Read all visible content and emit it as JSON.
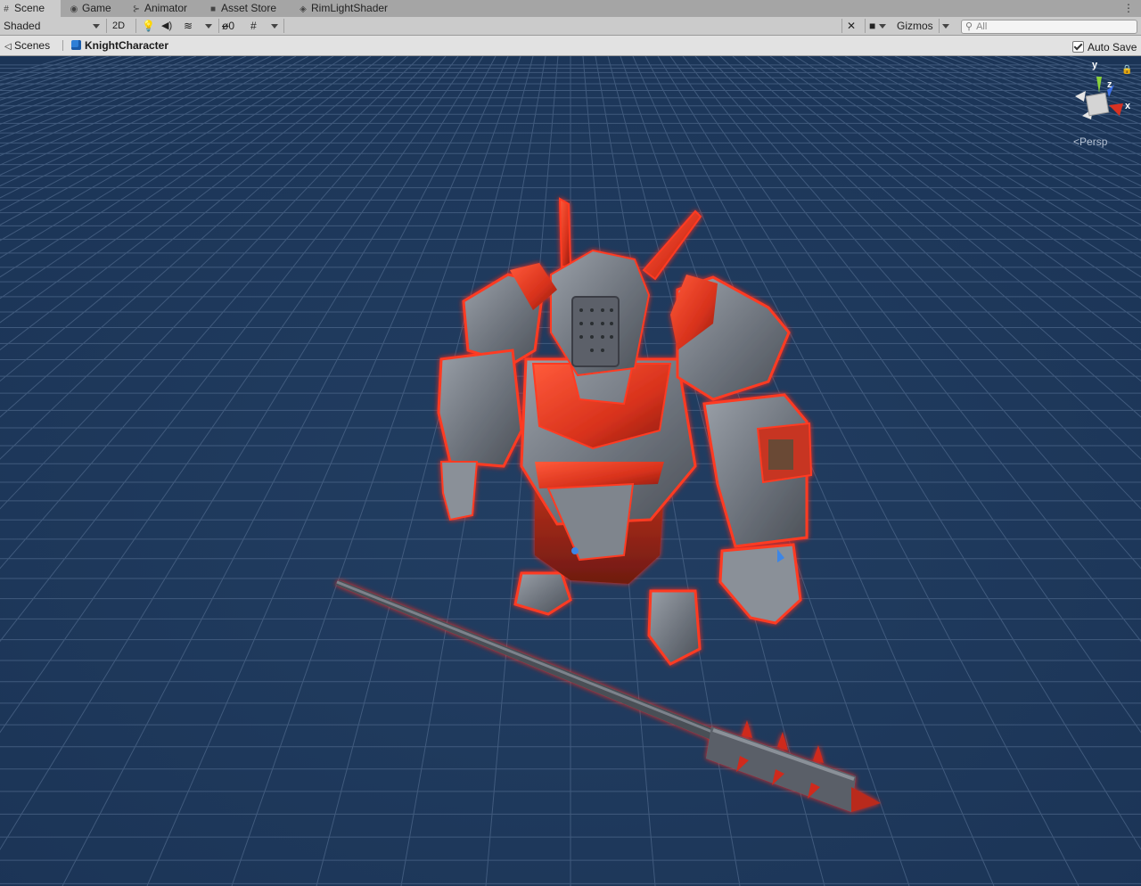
{
  "tabs": [
    {
      "label": "Scene",
      "icon": "grid-icon",
      "active": true
    },
    {
      "label": "Game",
      "icon": "gamepad-icon",
      "active": false
    },
    {
      "label": "Animator",
      "icon": "animator-icon",
      "active": false
    },
    {
      "label": "Asset Store",
      "icon": "bag-icon",
      "active": false
    },
    {
      "label": "RimLightShader",
      "icon": "shader-icon",
      "active": false
    }
  ],
  "toolbar": {
    "draw_mode": "Shaded",
    "two_d": "2D",
    "hidden_count": "0",
    "gizmos": "Gizmos",
    "search_placeholder": "All"
  },
  "breadcrumb": {
    "scenes": "Scenes",
    "current": "KnightCharacter",
    "auto_save": "Auto Save"
  },
  "gizmo": {
    "y": "y",
    "z": "z",
    "x": "x",
    "projection": "Persp"
  },
  "colors": {
    "viewport_bg": "#1f3a5c",
    "grid_line": "#4a6386",
    "rim_light": "#ff2a1a",
    "armor": "#7b7f86"
  }
}
